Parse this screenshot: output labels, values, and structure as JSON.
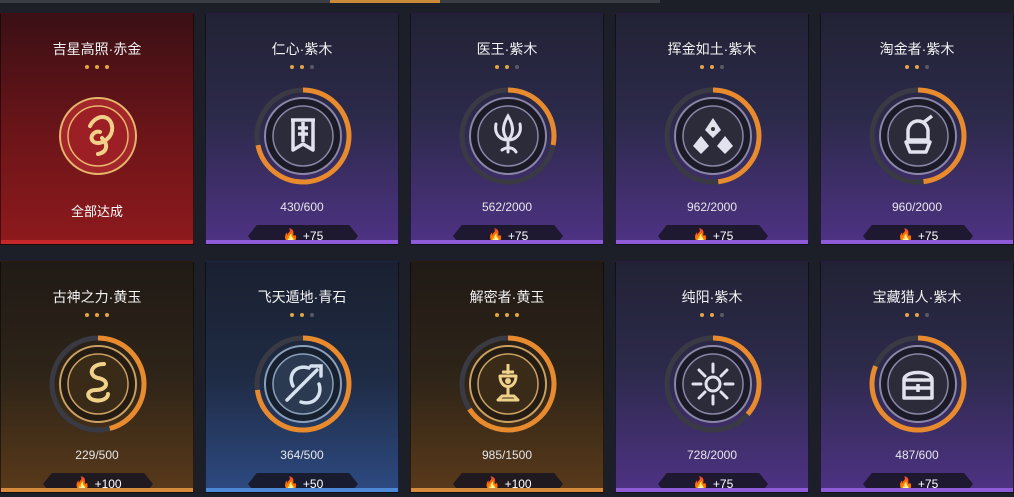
{
  "cards": [
    {
      "title": "吉星高照·赤金",
      "stars": 3,
      "stars_total": 3,
      "status": "全部达成",
      "reward": "",
      "progress": "",
      "theme": "red",
      "fill": 1.0,
      "icon": "fish-emblem-icon"
    },
    {
      "title": "仁心·紫木",
      "stars": 2,
      "stars_total": 3,
      "progress": "430/600",
      "reward": "+75",
      "theme": "purple",
      "fill": 0.717,
      "icon": "banner-icon"
    },
    {
      "title": "医王·紫木",
      "stars": 2,
      "stars_total": 3,
      "progress": "562/2000",
      "reward": "+75",
      "theme": "purple",
      "fill": 0.281,
      "icon": "lotus-icon"
    },
    {
      "title": "挥金如土·紫木",
      "stars": 2,
      "stars_total": 3,
      "progress": "962/2000",
      "reward": "+75",
      "theme": "purple",
      "fill": 0.481,
      "icon": "coins-icon"
    },
    {
      "title": "淘金者·紫木",
      "stars": 2,
      "stars_total": 3,
      "progress": "960/2000",
      "reward": "+75",
      "theme": "purple",
      "fill": 0.48,
      "icon": "treasure-hunter-icon"
    },
    {
      "title": "古神之力·黄玉",
      "stars": 3,
      "stars_total": 3,
      "progress": "229/500",
      "reward": "+100",
      "theme": "gold",
      "fill": 0.458,
      "icon": "serpent-icon"
    },
    {
      "title": "飞天遁地·青石",
      "stars": 2,
      "stars_total": 3,
      "progress": "364/500",
      "reward": "+50",
      "theme": "blue",
      "fill": 0.728,
      "icon": "spear-icon"
    },
    {
      "title": "解密者·黄玉",
      "stars": 3,
      "stars_total": 3,
      "progress": "985/1500",
      "reward": "+100",
      "theme": "gold",
      "fill": 0.657,
      "icon": "trophy-icon"
    },
    {
      "title": "纯阳·紫木",
      "stars": 2,
      "stars_total": 3,
      "progress": "728/2000",
      "reward": "+75",
      "theme": "purple",
      "fill": 0.364,
      "icon": "sun-icon"
    },
    {
      "title": "宝藏猎人·紫木",
      "stars": 2,
      "stars_total": 3,
      "progress": "487/600",
      "reward": "+75",
      "theme": "purple",
      "fill": 0.812,
      "icon": "treasure-chest-icon"
    }
  ],
  "colors": {
    "progress_arc": "#e88a2e",
    "progress_track": "#3a3a44",
    "star_on": "#e1a640",
    "star_off": "#5a5a66"
  }
}
